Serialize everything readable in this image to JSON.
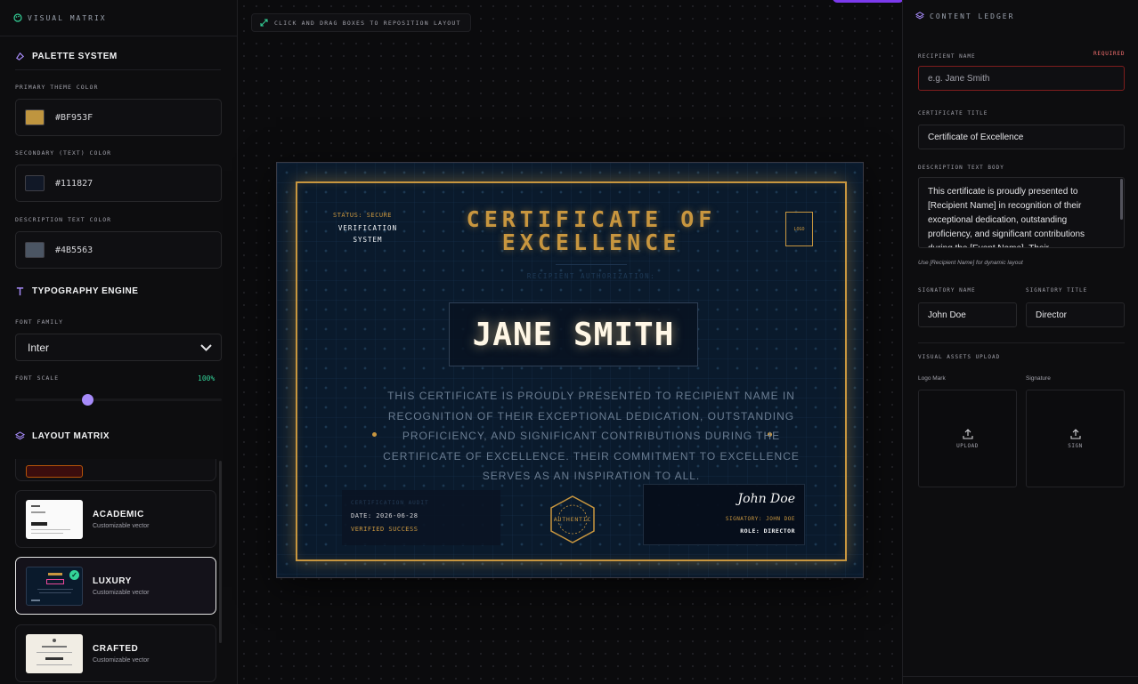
{
  "left_panel": {
    "header": "VISUAL MATRIX",
    "palette": {
      "title": "PALETTE SYSTEM",
      "primary_label": "PRIMARY THEME COLOR",
      "primary_hex": "#BF953F",
      "secondary_label": "SECONDARY (TEXT) COLOR",
      "secondary_hex": "#111827",
      "description_label": "DESCRIPTION TEXT COLOR",
      "description_hex": "#4B5563"
    },
    "typography": {
      "title": "TYPOGRAPHY ENGINE",
      "font_family_label": "FONT FAMILY",
      "font_family_value": "Inter",
      "font_scale_label": "FONT SCALE",
      "font_scale_value": "100%",
      "font_scale_fraction": 0.35
    },
    "layout": {
      "title": "LAYOUT MATRIX",
      "cards": [
        {
          "name": "ACADEMIC",
          "sub": "Customizable vector",
          "selected": false
        },
        {
          "name": "LUXURY",
          "sub": "Customizable vector",
          "selected": true
        },
        {
          "name": "CRAFTED",
          "sub": "Customizable vector",
          "selected": false
        }
      ]
    }
  },
  "canvas": {
    "hint": "CLICK AND DRAG BOXES TO REPOSITION LAYOUT"
  },
  "certificate": {
    "status": "STATUS: SECURE",
    "verification_line1": "VERIFICATION",
    "verification_line2": "SYSTEM",
    "title_line1": "CERTIFICATE OF",
    "title_line2": "EXCELLENCE",
    "logo_placeholder": "LOGO",
    "recipient_label": "RECIPIENT AUTHORIZATION:",
    "recipient_name": "JANE SMITH",
    "description": "THIS CERTIFICATE IS PROUDLY PRESENTED TO RECIPIENT NAME IN RECOGNITION OF THEIR EXCEPTIONAL DEDICATION, OUTSTANDING PROFICIENCY, AND SIGNIFICANT CONTRIBUTIONS DURING THE CERTIFICATE OF EXCELLENCE. THEIR COMMITMENT TO EXCELLENCE SERVES AS AN INSPIRATION TO ALL.",
    "cert_audit_label": "CERTIFICATION AUDIT",
    "date": "DATE: 2026-06-28",
    "verified": "VERIFIED SUCCESS",
    "seal_text": "AUTHENTIC",
    "signature": "John Doe",
    "signatory_line": "SIGNATORY: JOHN DOE",
    "role_line": "ROLE: DIRECTOR"
  },
  "right_panel": {
    "header": "CONTENT LEDGER",
    "recipient_label": "RECIPIENT NAME",
    "required": "REQUIRED",
    "recipient_placeholder": "e.g. Jane Smith",
    "title_label": "CERTIFICATE TITLE",
    "title_value": "Certificate of Excellence",
    "desc_label": "DESCRIPTION TEXT BODY",
    "desc_value": "This certificate is proudly presented to [Recipient Name] in recognition of their exceptional dedication, outstanding proficiency, and significant contributions during the [Event Name]. Their",
    "desc_hint": "Use [Recipient Name] for dynamic layout",
    "signatory_name_label": "SIGNATORY NAME",
    "signatory_name_value": "John Doe",
    "signatory_title_label": "SIGNATORY TITLE",
    "signatory_title_value": "Director",
    "assets_label": "VISUAL ASSETS UPLOAD",
    "logo_mark_label": "Logo Mark",
    "signature_label": "Signature",
    "upload_label": "UPLOAD",
    "sign_label": "SIGN"
  },
  "colors": {
    "accent": "#c8963f",
    "violet": "#a78bfa",
    "green": "#34d399",
    "required_red": "#f87171"
  }
}
